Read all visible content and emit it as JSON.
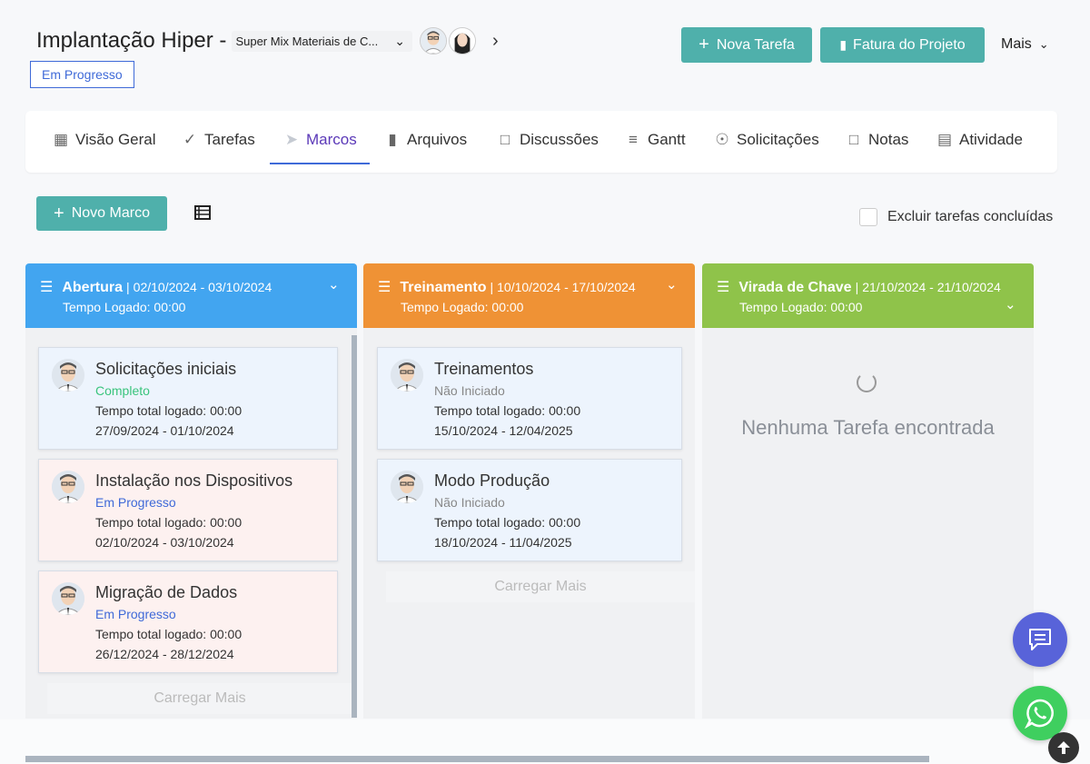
{
  "header": {
    "title": "Implantação Hiper -",
    "client": "Super Mix Materiais de C...",
    "status": "Em Progresso",
    "new_task": "Nova Tarefa",
    "invoice": "Fatura do Projeto",
    "more": "Mais"
  },
  "tabs": [
    {
      "label": "Visão Geral",
      "icon": "grid-icon"
    },
    {
      "label": "Tarefas",
      "icon": "check-circle-icon"
    },
    {
      "label": "Marcos",
      "icon": "rocket-icon"
    },
    {
      "label": "Arquivos",
      "icon": "file-icon"
    },
    {
      "label": "Discussões",
      "icon": "chat-icon"
    },
    {
      "label": "Gantt",
      "icon": "gantt-icon"
    },
    {
      "label": "Solicitações",
      "icon": "lifebuoy-icon"
    },
    {
      "label": "Notas",
      "icon": "note-icon"
    },
    {
      "label": "Atividade",
      "icon": "document-icon"
    }
  ],
  "toolbar": {
    "new_milestone": "Novo Marco",
    "exclude_completed": "Excluir tarefas concluídas"
  },
  "milestones": [
    {
      "name": "Abertura",
      "dates": "02/10/2024 - 03/10/2024",
      "logged": "Tempo Logado: 00:00",
      "color": "#42a5f0",
      "tasks": [
        {
          "title": "Solicitações iniciais",
          "status": "Completo",
          "logged": "Tempo total logado: 00:00",
          "dates": "27/09/2024 - 01/10/2024"
        },
        {
          "title": "Instalação nos Dispositivos",
          "status": "Em Progresso",
          "logged": "Tempo total logado: 00:00",
          "dates": "02/10/2024 - 03/10/2024"
        },
        {
          "title": "Migração de Dados",
          "status": "Em Progresso",
          "logged": "Tempo total logado: 00:00",
          "dates": "26/12/2024 - 28/12/2024"
        }
      ],
      "load_more": "Carregar Mais"
    },
    {
      "name": "Treinamento",
      "dates": "10/10/2024 - 17/10/2024",
      "logged": "Tempo Logado: 00:00",
      "color": "#ef9235",
      "tasks": [
        {
          "title": "Treinamentos",
          "status": "Não Iniciado",
          "logged": "Tempo total logado: 00:00",
          "dates": "15/10/2024 - 12/04/2025"
        },
        {
          "title": "Modo Produção",
          "status": "Não Iniciado",
          "logged": "Tempo total logado: 00:00",
          "dates": "18/10/2024 - 11/04/2025"
        }
      ],
      "load_more": "Carregar Mais"
    },
    {
      "name": "Virada de Chave",
      "dates": "21/10/2024 - 21/10/2024",
      "logged": "Tempo Logado: 00:00",
      "color": "#8fc34a",
      "empty": "Nenhuma Tarefa encontrada"
    }
  ]
}
